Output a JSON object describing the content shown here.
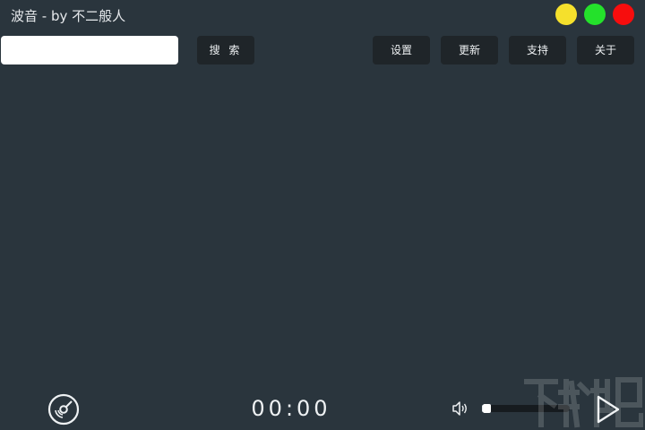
{
  "window": {
    "title": "波音 - by 不二般人",
    "controls": {
      "minimize": {
        "icon": "yellow-circle-icon",
        "color": "#f5e02c"
      },
      "maximize": {
        "icon": "green-circle-icon",
        "color": "#24e12b"
      },
      "close": {
        "icon": "red-circle-icon",
        "color": "#f70d0d"
      }
    }
  },
  "toolbar": {
    "search": {
      "value": "",
      "placeholder": ""
    },
    "search_label": "搜 索",
    "settings_label": "设置",
    "update_label": "更新",
    "support_label": "支持",
    "about_label": "关于"
  },
  "player": {
    "disc_icon": "disc-icon",
    "time": "00:00",
    "volume_icon": "speaker-icon",
    "volume_level": 0.03,
    "play_icon": "play-icon"
  },
  "colors": {
    "background": "#2a353d",
    "button_bg": "#1f2529",
    "text": "#eef1f3"
  }
}
